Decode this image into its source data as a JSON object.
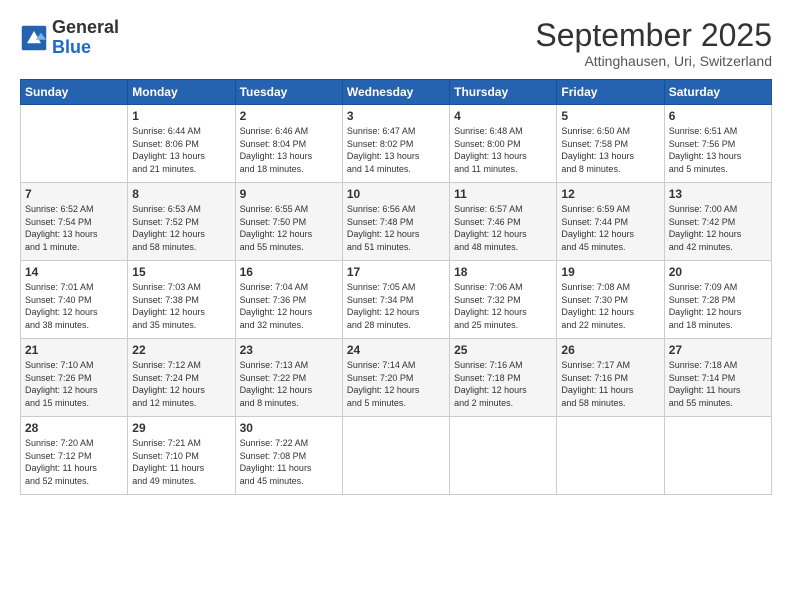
{
  "header": {
    "logo_line1": "General",
    "logo_line2": "Blue",
    "month_title": "September 2025",
    "location": "Attinghausen, Uri, Switzerland"
  },
  "days_of_week": [
    "Sunday",
    "Monday",
    "Tuesday",
    "Wednesday",
    "Thursday",
    "Friday",
    "Saturday"
  ],
  "weeks": [
    [
      {
        "num": "",
        "info": ""
      },
      {
        "num": "1",
        "info": "Sunrise: 6:44 AM\nSunset: 8:06 PM\nDaylight: 13 hours\nand 21 minutes."
      },
      {
        "num": "2",
        "info": "Sunrise: 6:46 AM\nSunset: 8:04 PM\nDaylight: 13 hours\nand 18 minutes."
      },
      {
        "num": "3",
        "info": "Sunrise: 6:47 AM\nSunset: 8:02 PM\nDaylight: 13 hours\nand 14 minutes."
      },
      {
        "num": "4",
        "info": "Sunrise: 6:48 AM\nSunset: 8:00 PM\nDaylight: 13 hours\nand 11 minutes."
      },
      {
        "num": "5",
        "info": "Sunrise: 6:50 AM\nSunset: 7:58 PM\nDaylight: 13 hours\nand 8 minutes."
      },
      {
        "num": "6",
        "info": "Sunrise: 6:51 AM\nSunset: 7:56 PM\nDaylight: 13 hours\nand 5 minutes."
      }
    ],
    [
      {
        "num": "7",
        "info": "Sunrise: 6:52 AM\nSunset: 7:54 PM\nDaylight: 13 hours\nand 1 minute."
      },
      {
        "num": "8",
        "info": "Sunrise: 6:53 AM\nSunset: 7:52 PM\nDaylight: 12 hours\nand 58 minutes."
      },
      {
        "num": "9",
        "info": "Sunrise: 6:55 AM\nSunset: 7:50 PM\nDaylight: 12 hours\nand 55 minutes."
      },
      {
        "num": "10",
        "info": "Sunrise: 6:56 AM\nSunset: 7:48 PM\nDaylight: 12 hours\nand 51 minutes."
      },
      {
        "num": "11",
        "info": "Sunrise: 6:57 AM\nSunset: 7:46 PM\nDaylight: 12 hours\nand 48 minutes."
      },
      {
        "num": "12",
        "info": "Sunrise: 6:59 AM\nSunset: 7:44 PM\nDaylight: 12 hours\nand 45 minutes."
      },
      {
        "num": "13",
        "info": "Sunrise: 7:00 AM\nSunset: 7:42 PM\nDaylight: 12 hours\nand 42 minutes."
      }
    ],
    [
      {
        "num": "14",
        "info": "Sunrise: 7:01 AM\nSunset: 7:40 PM\nDaylight: 12 hours\nand 38 minutes."
      },
      {
        "num": "15",
        "info": "Sunrise: 7:03 AM\nSunset: 7:38 PM\nDaylight: 12 hours\nand 35 minutes."
      },
      {
        "num": "16",
        "info": "Sunrise: 7:04 AM\nSunset: 7:36 PM\nDaylight: 12 hours\nand 32 minutes."
      },
      {
        "num": "17",
        "info": "Sunrise: 7:05 AM\nSunset: 7:34 PM\nDaylight: 12 hours\nand 28 minutes."
      },
      {
        "num": "18",
        "info": "Sunrise: 7:06 AM\nSunset: 7:32 PM\nDaylight: 12 hours\nand 25 minutes."
      },
      {
        "num": "19",
        "info": "Sunrise: 7:08 AM\nSunset: 7:30 PM\nDaylight: 12 hours\nand 22 minutes."
      },
      {
        "num": "20",
        "info": "Sunrise: 7:09 AM\nSunset: 7:28 PM\nDaylight: 12 hours\nand 18 minutes."
      }
    ],
    [
      {
        "num": "21",
        "info": "Sunrise: 7:10 AM\nSunset: 7:26 PM\nDaylight: 12 hours\nand 15 minutes."
      },
      {
        "num": "22",
        "info": "Sunrise: 7:12 AM\nSunset: 7:24 PM\nDaylight: 12 hours\nand 12 minutes."
      },
      {
        "num": "23",
        "info": "Sunrise: 7:13 AM\nSunset: 7:22 PM\nDaylight: 12 hours\nand 8 minutes."
      },
      {
        "num": "24",
        "info": "Sunrise: 7:14 AM\nSunset: 7:20 PM\nDaylight: 12 hours\nand 5 minutes."
      },
      {
        "num": "25",
        "info": "Sunrise: 7:16 AM\nSunset: 7:18 PM\nDaylight: 12 hours\nand 2 minutes."
      },
      {
        "num": "26",
        "info": "Sunrise: 7:17 AM\nSunset: 7:16 PM\nDaylight: 11 hours\nand 58 minutes."
      },
      {
        "num": "27",
        "info": "Sunrise: 7:18 AM\nSunset: 7:14 PM\nDaylight: 11 hours\nand 55 minutes."
      }
    ],
    [
      {
        "num": "28",
        "info": "Sunrise: 7:20 AM\nSunset: 7:12 PM\nDaylight: 11 hours\nand 52 minutes."
      },
      {
        "num": "29",
        "info": "Sunrise: 7:21 AM\nSunset: 7:10 PM\nDaylight: 11 hours\nand 49 minutes."
      },
      {
        "num": "30",
        "info": "Sunrise: 7:22 AM\nSunset: 7:08 PM\nDaylight: 11 hours\nand 45 minutes."
      },
      {
        "num": "",
        "info": ""
      },
      {
        "num": "",
        "info": ""
      },
      {
        "num": "",
        "info": ""
      },
      {
        "num": "",
        "info": ""
      }
    ]
  ]
}
